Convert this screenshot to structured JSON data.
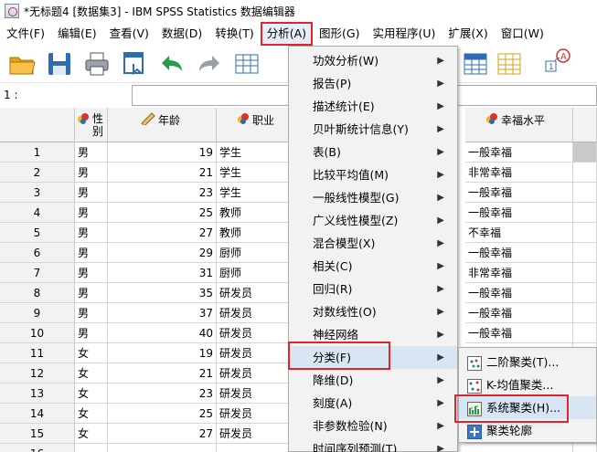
{
  "window": {
    "title": "*无标题4 [数据集3] - IBM SPSS Statistics 数据编辑器"
  },
  "menubar": [
    "文件(F)",
    "编辑(E)",
    "查看(V)",
    "数据(D)",
    "转换(T)",
    "分析(A)",
    "图形(G)",
    "实用程序(U)",
    "扩展(X)",
    "窗口(W)"
  ],
  "cellbar": {
    "ref": "1 :"
  },
  "columns": [
    "性别",
    "年龄",
    "职业",
    "幸福水平"
  ],
  "rows": [
    {
      "n": "1",
      "gender": "男",
      "age": "19",
      "job": "学生",
      "happy": "一般幸福"
    },
    {
      "n": "2",
      "gender": "男",
      "age": "21",
      "job": "学生",
      "happy": "非常幸福"
    },
    {
      "n": "3",
      "gender": "男",
      "age": "23",
      "job": "学生",
      "happy": "一般幸福"
    },
    {
      "n": "4",
      "gender": "男",
      "age": "25",
      "job": "教师",
      "happy": "一般幸福"
    },
    {
      "n": "5",
      "gender": "男",
      "age": "27",
      "job": "教师",
      "happy": "不幸福"
    },
    {
      "n": "6",
      "gender": "男",
      "age": "29",
      "job": "厨师",
      "happy": "一般幸福"
    },
    {
      "n": "7",
      "gender": "男",
      "age": "31",
      "job": "厨师",
      "happy": "非常幸福"
    },
    {
      "n": "8",
      "gender": "男",
      "age": "35",
      "job": "研发员",
      "happy": "一般幸福"
    },
    {
      "n": "9",
      "gender": "男",
      "age": "37",
      "job": "研发员",
      "happy": "一般幸福"
    },
    {
      "n": "10",
      "gender": "男",
      "age": "40",
      "job": "研发员",
      "happy": "一般幸福"
    },
    {
      "n": "11",
      "gender": "女",
      "age": "19",
      "job": "研发员",
      "happy": ""
    },
    {
      "n": "12",
      "gender": "女",
      "age": "21",
      "job": "研发员",
      "happy": ""
    },
    {
      "n": "13",
      "gender": "女",
      "age": "23",
      "job": "研发员",
      "happy": ""
    },
    {
      "n": "14",
      "gender": "女",
      "age": "25",
      "job": "研发员",
      "happy": ""
    },
    {
      "n": "15",
      "gender": "女",
      "age": "27",
      "job": "研发员",
      "happy": ""
    },
    {
      "n": "16",
      "gender": "",
      "age": "",
      "job": "",
      "happy": ""
    }
  ],
  "analyze_menu": [
    {
      "label": "功效分析(W)",
      "submenu": true
    },
    {
      "label": "报告(P)",
      "submenu": true
    },
    {
      "label": "描述统计(E)",
      "submenu": true
    },
    {
      "label": "贝叶斯统计信息(Y)",
      "submenu": true
    },
    {
      "label": "表(B)",
      "submenu": true
    },
    {
      "label": "比较平均值(M)",
      "submenu": true
    },
    {
      "label": "一般线性模型(G)",
      "submenu": true
    },
    {
      "label": "广义线性模型(Z)",
      "submenu": true
    },
    {
      "label": "混合模型(X)",
      "submenu": true
    },
    {
      "label": "相关(C)",
      "submenu": true
    },
    {
      "label": "回归(R)",
      "submenu": true
    },
    {
      "label": "对数线性(O)",
      "submenu": true
    },
    {
      "label": "神经网络",
      "submenu": true
    },
    {
      "label": "分类(F)",
      "submenu": true,
      "highlighted": true
    },
    {
      "label": "降维(D)",
      "submenu": true
    },
    {
      "label": "刻度(A)",
      "submenu": true
    },
    {
      "label": "非参数检验(N)",
      "submenu": true
    },
    {
      "label": "时间序列预测(T)",
      "submenu": true
    }
  ],
  "classify_menu": [
    {
      "label": "二阶聚类(T)...",
      "icon": "twostep-cluster-icon"
    },
    {
      "label": "K-均值聚类...",
      "icon": "kmeans-cluster-icon"
    },
    {
      "label": "系统聚类(H)...",
      "icon": "hierarchical-cluster-icon",
      "highlighted": true
    },
    {
      "label": "聚类轮廓",
      "icon": "cluster-silhouette-icon"
    }
  ]
}
